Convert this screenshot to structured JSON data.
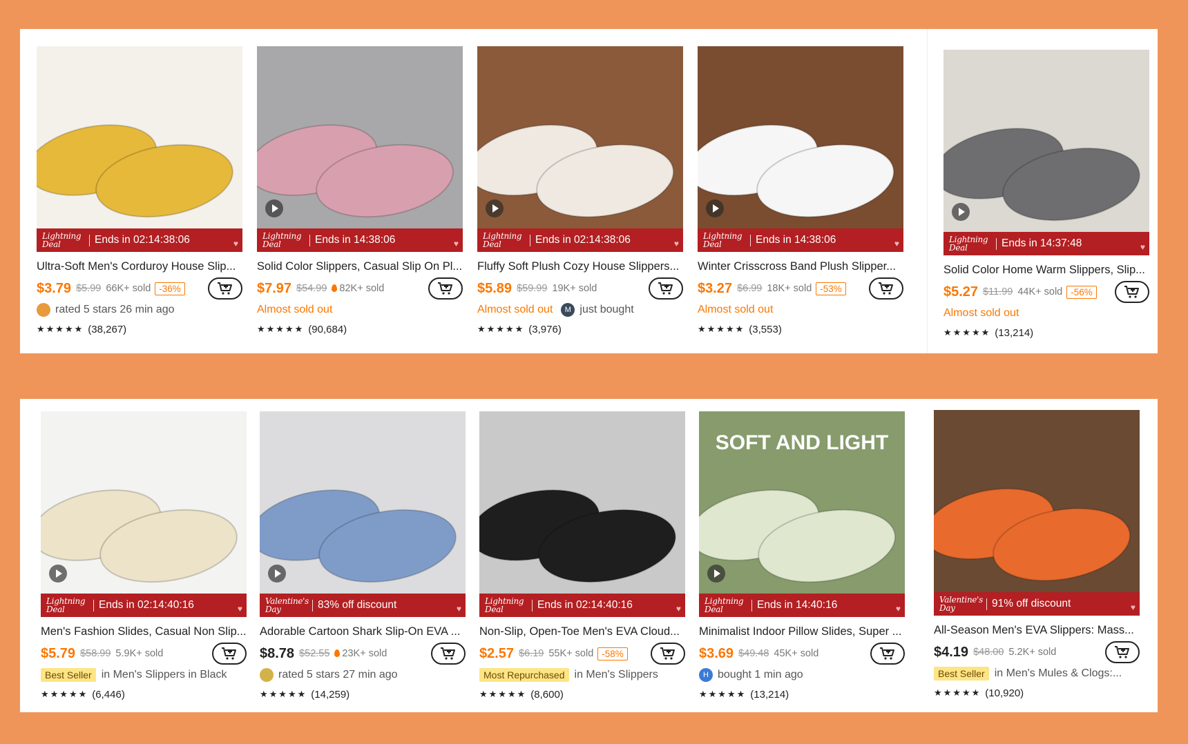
{
  "products_top": [
    {
      "name": "yellow-corduroy-slippers",
      "title": "Ultra-Soft Men's Corduroy House Slip...",
      "price": "$3.79",
      "original": "$5.99",
      "sold": "66K+ sold",
      "flame": false,
      "discount": "-36%",
      "deal_badge": "Lightning Deal",
      "deal_text": "Ends in 02:14:38:06",
      "video": false,
      "info_type": "avatar",
      "info_text": "rated 5 stars 26 min ago",
      "avatar_letter": "",
      "avatar_color": "#e89a3c",
      "rating_count": "(38,267)",
      "image_bg": "#f4f1ea",
      "image_accent": "#e6b93a"
    },
    {
      "name": "pink-plush-slippers",
      "title": "Solid Color Slippers, Casual Slip On Pl...",
      "price": "$7.97",
      "original": "$54.99",
      "sold": "82K+ sold",
      "flame": true,
      "discount": "",
      "deal_badge": "Lightning Deal",
      "deal_text": "Ends in 14:38:06",
      "video": true,
      "info_type": "almost",
      "info_text": "Almost sold out",
      "rating_count": "(90,684)",
      "image_bg": "#a8a8aa",
      "image_accent": "#d8a0ae"
    },
    {
      "name": "fluffy-plush-slippers",
      "title": "Fluffy Soft Plush Cozy House Slippers...",
      "price": "$5.89",
      "original": "$59.99",
      "sold": "19K+ sold",
      "flame": false,
      "discount": "",
      "deal_badge": "Lightning Deal",
      "deal_text": "Ends in 02:14:38:06",
      "video": true,
      "info_type": "almost-avatar",
      "info_text": "Almost sold out",
      "info_text2": "just bought",
      "avatar_letter": "M",
      "avatar_color": "#3a4a5c",
      "rating_count": "(3,976)",
      "image_bg": "#8a5a3a",
      "image_accent": "#efe9e2"
    },
    {
      "name": "crisscross-plush-slippers",
      "title": "Winter Crisscross Band Plush Slipper...",
      "price": "$3.27",
      "original": "$6.99",
      "sold": "18K+ sold",
      "flame": false,
      "discount": "-53%",
      "deal_badge": "Lightning Deal",
      "deal_text": "Ends in 14:38:06",
      "video": true,
      "info_type": "almost",
      "info_text": "Almost sold out",
      "rating_count": "(3,553)",
      "image_bg": "#7a4d30",
      "image_accent": "#f6f6f6"
    },
    {
      "name": "knit-home-slippers",
      "title": "Solid Color Home Warm Slippers, Slip...",
      "price": "$5.27",
      "original": "$11.99",
      "sold": "44K+ sold",
      "flame": false,
      "discount": "-56%",
      "deal_badge": "Lightning Deal",
      "deal_text": "Ends in 14:37:48",
      "video": true,
      "info_type": "almost",
      "info_text": "Almost sold out",
      "rating_count": "(13,214)",
      "image_bg": "#dcd9d3",
      "image_accent": "#6e6e70"
    }
  ],
  "products_bottom": [
    {
      "name": "fashion-slides",
      "title": "Men's Fashion Slides, Casual Non Slip...",
      "price": "$5.79",
      "original": "$58.99",
      "sold": "5.9K+ sold",
      "flame": false,
      "discount": "",
      "deal_badge": "Lightning Deal",
      "deal_text": "Ends in 02:14:40:16",
      "video": true,
      "info_type": "tag",
      "tag": "Best Seller",
      "info_text": "in Men's Slippers in Black",
      "rating_count": "(6,446)",
      "image_bg": "#f3f3f1",
      "image_accent": "#ece3c8"
    },
    {
      "name": "shark-slides",
      "title": "Adorable Cartoon Shark Slip-On EVA ...",
      "price": "$8.78",
      "original": "$52.55",
      "sold": "23K+ sold",
      "flame": true,
      "discount": "",
      "deal_badge": "Valentine's Day",
      "deal_text": "83% off discount",
      "video": true,
      "info_type": "avatar",
      "info_text": "rated 5 stars 27 min ago",
      "avatar_letter": "",
      "avatar_color": "#d4b24a",
      "rating_count": "(14,259)",
      "image_bg": "#dcdcde",
      "image_accent": "#7f9cc9",
      "price_black": true
    },
    {
      "name": "eva-cloud-slides",
      "title": "Non-Slip, Open-Toe Men's EVA Cloud...",
      "price": "$2.57",
      "original": "$6.19",
      "sold": "55K+ sold",
      "flame": false,
      "discount": "-58%",
      "deal_badge": "Lightning Deal",
      "deal_text": "Ends in 02:14:40:16",
      "video": false,
      "info_type": "tag",
      "tag": "Most Repurchased",
      "info_text": "in Men's Slippers",
      "rating_count": "(8,600)",
      "image_bg": "#c9c9c9",
      "image_accent": "#1e1e1e"
    },
    {
      "name": "pillow-slides",
      "title": "Minimalist Indoor Pillow Slides, Super ...",
      "price": "$3.69",
      "original": "$49.48",
      "sold": "45K+ sold",
      "flame": false,
      "discount": "",
      "deal_badge": "Lightning Deal",
      "deal_text": "Ends in 14:40:16",
      "video": true,
      "info_type": "avatar",
      "info_text": "bought 1 min ago",
      "avatar_letter": "H",
      "avatar_color": "#3b7bd6",
      "rating_count": "(13,214)",
      "image_bg": "#879b6c",
      "image_accent": "#dfe8cf",
      "image_caption": "SOFT AND LIGHT"
    },
    {
      "name": "massage-eva-slippers",
      "title": "All-Season Men's EVA Slippers: Mass...",
      "price": "$4.19",
      "original": "$48.00",
      "sold": "5.2K+ sold",
      "flame": false,
      "discount": "",
      "deal_badge": "Valentine's Day",
      "deal_text": "91% off discount",
      "video": false,
      "info_type": "tag",
      "tag": "Best Seller",
      "info_text": "in Men's Mules & Clogs:...",
      "rating_count": "(10,920)",
      "image_bg": "#6a4a32",
      "image_accent": "#e86a2c",
      "price_black": true
    }
  ],
  "rating_stars": "★★★★★"
}
